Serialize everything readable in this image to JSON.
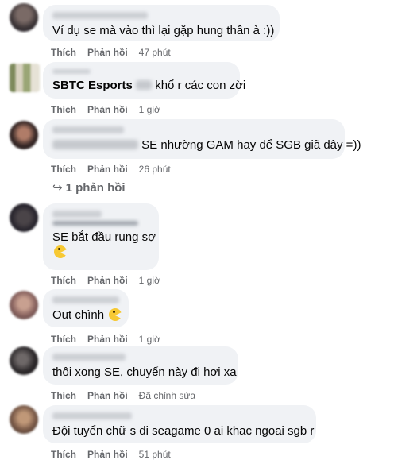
{
  "comments": [
    {
      "text": "Ví dụ se mà vào thì lại gặp hung thần à :))",
      "like": "Thích",
      "reply": "Phản hồi",
      "time": "47 phút"
    },
    {
      "author": "SBTC Esports",
      "text": "khổ r các con zời",
      "like": "Thích",
      "reply": "Phản hồi",
      "time": "1 giờ"
    },
    {
      "text": "SE nhường GAM hay để SGB giã đây =))",
      "like": "Thích",
      "reply": "Phản hồi",
      "time": "26 phút",
      "replies_label": "1 phản hồi"
    },
    {
      "text": "SE bắt đầu rung sợ",
      "like": "Thích",
      "reply": "Phản hồi",
      "time": "1 giờ"
    },
    {
      "text": "Out chình",
      "like": "Thích",
      "reply": "Phản hồi",
      "time": "1 giờ"
    },
    {
      "text": "thôi xong SE, chuyến này đi hơi xa",
      "like": "Thích",
      "reply": "Phản hồi",
      "time": "Đã chỉnh sửa"
    },
    {
      "text": "Đội tuyển chữ s đi seagame 0 ai khac ngoai sgb r",
      "like": "Thích",
      "reply": "Phản hồi",
      "time": "51 phút"
    }
  ],
  "colors": {
    "bubble": "#f0f2f5",
    "meta": "#65676b",
    "text": "#050505"
  }
}
